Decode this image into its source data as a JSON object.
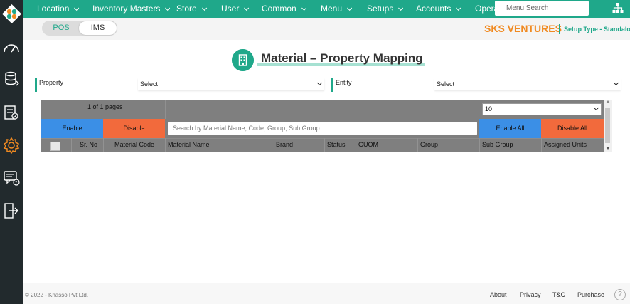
{
  "nav": {
    "items": [
      {
        "label": "Location"
      },
      {
        "label": "Inventory Masters"
      },
      {
        "label": "Store"
      },
      {
        "label": "User"
      },
      {
        "label": "Common"
      },
      {
        "label": "Menu"
      },
      {
        "label": "Setups"
      },
      {
        "label": "Accounts"
      },
      {
        "label": "Opera"
      }
    ],
    "search_placeholder": "Menu Search"
  },
  "sidebar": {
    "icons": [
      "dashboard-gauge-icon",
      "database-sync-icon",
      "clipboard-check-icon",
      "settings-gear-icon",
      "chat-help-icon",
      "logout-icon"
    ]
  },
  "toggle": {
    "pos_label": "POS",
    "ims_label": "IMS",
    "active": "IMS"
  },
  "company": {
    "name": "SKS VENTURES",
    "setup_type": "Setup Type - Standalone"
  },
  "page": {
    "title": "Material – Property Mapping"
  },
  "filters": {
    "property": {
      "label": "Property",
      "value": "Select"
    },
    "entity": {
      "label": "Entity",
      "value": "Select"
    }
  },
  "grid": {
    "pages_text": "1 of 1 pages",
    "page_size": "10",
    "enable_label": "Enable",
    "disable_label": "Disable",
    "search_placeholder": "Search by Material Name, Code, Group, Sub Group",
    "enable_all_label": "Enable All",
    "disable_all_label": "Disable All",
    "columns": [
      "Sr. No",
      "Material Code",
      "Material Name",
      "Brand",
      "Status",
      "GUOM",
      "Group",
      "Sub Group",
      "Assigned Units"
    ]
  },
  "footer": {
    "copyright": "© 2022 - Khasso Pvt Ltd.",
    "links": [
      "About",
      "Privacy",
      "T&C",
      "Purchase"
    ],
    "help": "?"
  },
  "colors": {
    "brand_teal": "#1fa88a",
    "rail": "#222a2d",
    "accent_orange": "#f08a21",
    "btn_blue": "#3b8fe6",
    "btn_orange": "#f26a3c"
  }
}
